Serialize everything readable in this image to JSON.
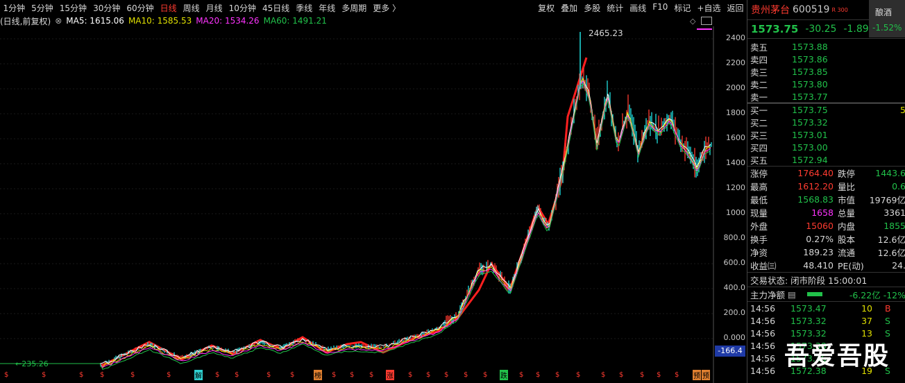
{
  "toolbar": {
    "left": [
      "1分钟",
      "5分钟",
      "15分钟",
      "30分钟",
      "60分钟",
      "日线",
      "周线",
      "月线",
      "10分钟",
      "45日线",
      "季线",
      "年线",
      "多周期",
      "更多 〉"
    ],
    "active_index": 5,
    "right": [
      "复权",
      "叠加",
      "多股",
      "统计",
      "画线",
      "F10",
      "标记",
      "+自选",
      "返回"
    ]
  },
  "legend": {
    "period": "(日线,前复权)",
    "ma5_label": "MA5: 1615.06",
    "ma10_label": "MA10: 1585.53",
    "ma20_label": "MA20: 1534.26",
    "ma60_label": "MA60: 1491.21",
    "colors": {
      "ma5": "#ffffff",
      "ma10": "#e0e000",
      "ma20": "#ff33ff",
      "ma60": "#21c14a"
    }
  },
  "chart": {
    "y_ticks": [
      "2400",
      "2200",
      "2000",
      "1800",
      "1600",
      "1400",
      "1200",
      "1000",
      "800.0",
      "600.0",
      "400.0",
      "200.0",
      "0.000",
      "-166.4"
    ],
    "high_label": "2465.23",
    "low_label": "235.26",
    "current_tag": "-166.4",
    "event_markers": [
      {
        "label": "解",
        "color": "#2fd0d0"
      },
      {
        "label": "榜",
        "color": "#e08030"
      },
      {
        "label": "涨",
        "color": "#ff3b30"
      },
      {
        "label": "跌",
        "color": "#21c14a"
      },
      {
        "label": "预",
        "color": "#e08030"
      }
    ],
    "dollar_glyph": "$"
  },
  "stock": {
    "name": "贵州茅台",
    "code": "600519",
    "badge": "R 300",
    "sector_name": "酿酒",
    "sector_pct": "-1.52%",
    "price": "1573.75",
    "change": "-30.25",
    "change_pct": "-1.89%"
  },
  "asks": [
    {
      "label": "卖五",
      "price": "1573.88"
    },
    {
      "label": "卖四",
      "price": "1573.86"
    },
    {
      "label": "卖三",
      "price": "1573.85"
    },
    {
      "label": "卖二",
      "price": "1573.80"
    },
    {
      "label": "卖一",
      "price": "1573.77"
    }
  ],
  "bids": [
    {
      "label": "买一",
      "price": "1573.75",
      "vol": "5"
    },
    {
      "label": "买二",
      "price": "1573.32",
      "vol": ""
    },
    {
      "label": "买三",
      "price": "1573.01",
      "vol": ""
    },
    {
      "label": "买四",
      "price": "1573.00",
      "vol": ""
    },
    {
      "label": "买五",
      "price": "1572.94",
      "vol": ""
    }
  ],
  "stats": [
    {
      "a": "涨停",
      "b": "1764.40",
      "bc": "red",
      "c": "跌停",
      "d": "1443.6",
      "dc": "green"
    },
    {
      "a": "最高",
      "b": "1612.20",
      "bc": "red",
      "c": "量比",
      "d": "0.6",
      "dc": "green"
    },
    {
      "a": "最低",
      "b": "1568.83",
      "bc": "green",
      "c": "市值",
      "d": "19769亿",
      "dc": "white"
    },
    {
      "a": "现量",
      "b": "1658",
      "bc": "mag",
      "c": "总量",
      "d": "3361",
      "dc": "white"
    },
    {
      "a": "外盘",
      "b": "15060",
      "bc": "red",
      "c": "内盘",
      "d": "1855",
      "dc": "green"
    },
    {
      "a": "换手",
      "b": "0.27%",
      "bc": "white",
      "c": "股本",
      "d": "12.6亿",
      "dc": "white"
    },
    {
      "a": "净资",
      "b": "189.23",
      "bc": "white",
      "c": "流通",
      "d": "12.6亿",
      "dc": "white"
    },
    {
      "a": "收益㈢",
      "b": "48.410",
      "bc": "white",
      "c": "PE(动)",
      "d": "24.",
      "dc": "white"
    }
  ],
  "trade_status": "交易状态: 闭市阶段 15:00:01",
  "main_flow": {
    "label": "主力净额",
    "value": "-6.22亿 -12%"
  },
  "ticks": [
    {
      "t": "14:56",
      "p": "1573.47",
      "q": "10",
      "s": "B",
      "sc": "red"
    },
    {
      "t": "14:56",
      "p": "1573.32",
      "q": "37",
      "s": "S",
      "sc": "green"
    },
    {
      "t": "14:56",
      "p": "1573.32",
      "q": "13",
      "s": "S",
      "sc": "green"
    },
    {
      "t": "14:56",
      "p": "1573.38",
      "q": "",
      "s": "",
      "sc": "green"
    },
    {
      "t": "14:56",
      "p": "1573.36",
      "q": "",
      "s": "",
      "sc": "green"
    },
    {
      "t": "14:56",
      "p": "1572.38",
      "q": "19",
      "s": "S",
      "sc": "green"
    }
  ],
  "watermark": "吾爱吾股"
}
